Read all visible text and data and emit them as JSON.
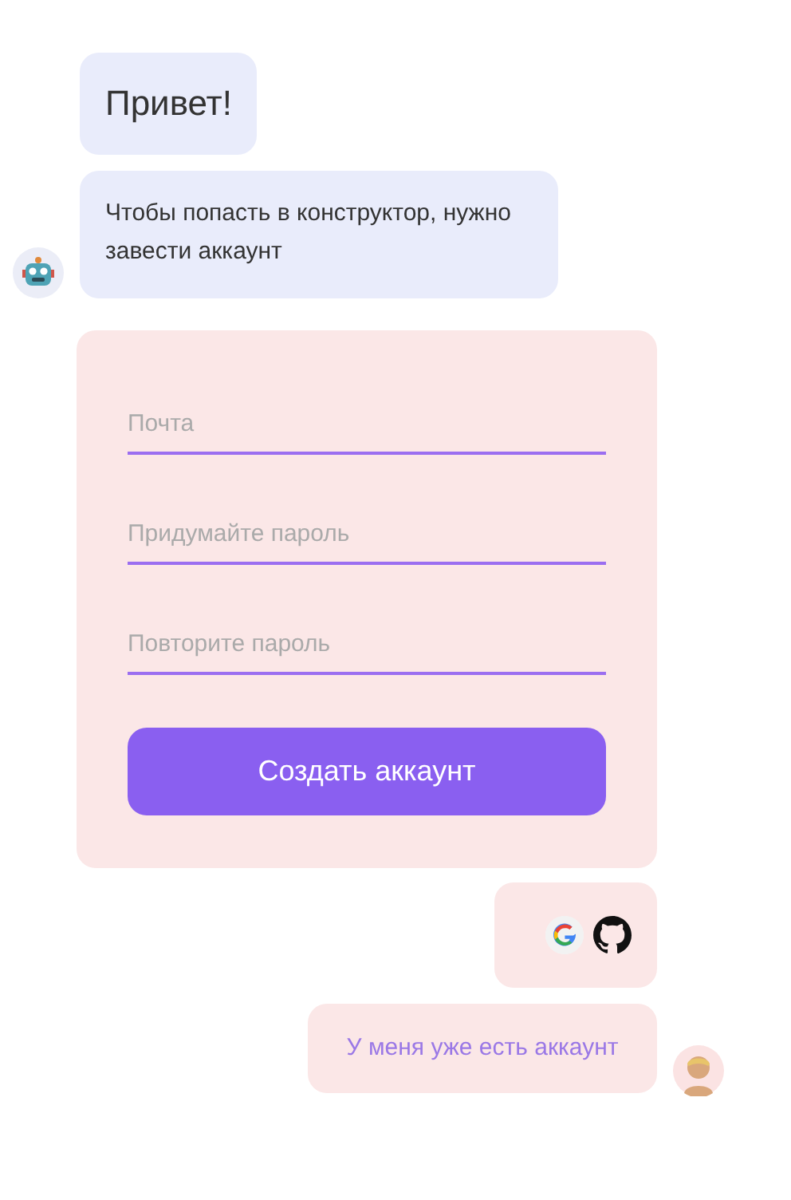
{
  "messages": [
    {
      "text": "Привет!",
      "kind": "big"
    },
    {
      "text": "Чтобы попасть в конструктор, нужно завести аккаунт",
      "kind": "normal"
    }
  ],
  "form": {
    "fields": [
      {
        "placeholder": "Почта"
      },
      {
        "placeholder": "Придумайте пароль"
      },
      {
        "placeholder": "Повторите пароль"
      }
    ],
    "submit": "Создать аккаунт"
  },
  "reply": {
    "link": "У меня уже есть аккаунт"
  }
}
